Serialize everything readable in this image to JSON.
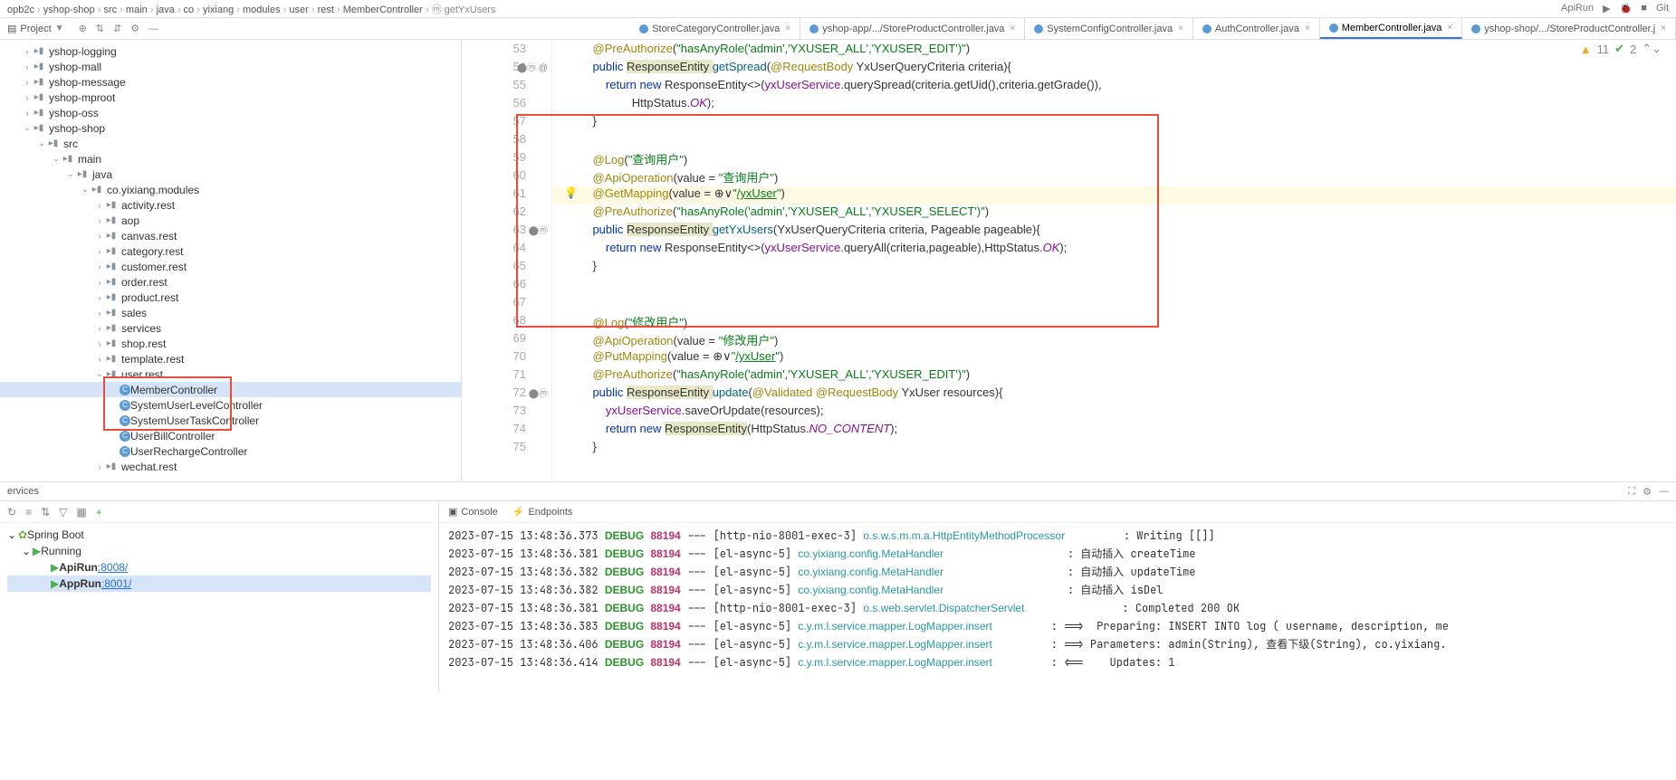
{
  "breadcrumbs": [
    "opb2c",
    "yshop-shop",
    "src",
    "main",
    "java",
    "co",
    "yixiang",
    "modules",
    "user",
    "rest",
    "MemberController"
  ],
  "topright_method": "getYxUsers",
  "topright_labels": [
    "ApiRun",
    "Git"
  ],
  "project_label": "Project",
  "file_tabs": [
    {
      "name": "StoreCategoryController.java",
      "active": false
    },
    {
      "name": "yshop-app/.../StoreProductController.java",
      "active": false
    },
    {
      "name": "SystemConfigController.java",
      "active": false
    },
    {
      "name": "AuthController.java",
      "active": false
    },
    {
      "name": "MemberController.java",
      "active": true
    },
    {
      "name": "yshop-shop/.../StoreProductController.j",
      "active": false
    }
  ],
  "lint_warn": "11",
  "lint_ok": "2",
  "tree": [
    {
      "ind": 1,
      "exp": "›",
      "icon": "folder",
      "label": "yshop-logging"
    },
    {
      "ind": 1,
      "exp": "›",
      "icon": "folder",
      "label": "yshop-mall"
    },
    {
      "ind": 1,
      "exp": "›",
      "icon": "folder",
      "label": "yshop-message"
    },
    {
      "ind": 1,
      "exp": "›",
      "icon": "folder",
      "label": "yshop-mproot"
    },
    {
      "ind": 1,
      "exp": "›",
      "icon": "folder",
      "label": "yshop-oss"
    },
    {
      "ind": 1,
      "exp": "⌄",
      "icon": "folder",
      "label": "yshop-shop"
    },
    {
      "ind": 2,
      "exp": "⌄",
      "icon": "folder",
      "label": "src"
    },
    {
      "ind": 3,
      "exp": "⌄",
      "icon": "folder",
      "label": "main"
    },
    {
      "ind": 4,
      "exp": "⌄",
      "icon": "folder",
      "label": "java"
    },
    {
      "ind": 5,
      "exp": "⌄",
      "icon": "folder",
      "label": "co.yixiang.modules"
    },
    {
      "ind": 6,
      "exp": "›",
      "icon": "folder",
      "label": "activity.rest"
    },
    {
      "ind": 6,
      "exp": "›",
      "icon": "folder",
      "label": "aop"
    },
    {
      "ind": 6,
      "exp": "›",
      "icon": "folder",
      "label": "canvas.rest"
    },
    {
      "ind": 6,
      "exp": "›",
      "icon": "folder",
      "label": "category.rest"
    },
    {
      "ind": 6,
      "exp": "›",
      "icon": "folder",
      "label": "customer.rest"
    },
    {
      "ind": 6,
      "exp": "›",
      "icon": "folder",
      "label": "order.rest"
    },
    {
      "ind": 6,
      "exp": "›",
      "icon": "folder",
      "label": "product.rest"
    },
    {
      "ind": 6,
      "exp": "›",
      "icon": "folder",
      "label": "sales"
    },
    {
      "ind": 6,
      "exp": "›",
      "icon": "folder",
      "label": "services"
    },
    {
      "ind": 6,
      "exp": "›",
      "icon": "folder",
      "label": "shop.rest"
    },
    {
      "ind": 6,
      "exp": "›",
      "icon": "folder",
      "label": "template.rest"
    },
    {
      "ind": 6,
      "exp": "⌄",
      "icon": "folder",
      "label": "user.rest"
    },
    {
      "ind": 7,
      "exp": "",
      "icon": "java",
      "label": "MemberController",
      "sel": true
    },
    {
      "ind": 7,
      "exp": "",
      "icon": "java",
      "label": "SystemUserLevelController"
    },
    {
      "ind": 7,
      "exp": "",
      "icon": "java",
      "label": "SystemUserTaskController"
    },
    {
      "ind": 7,
      "exp": "",
      "icon": "java",
      "label": "UserBillController"
    },
    {
      "ind": 7,
      "exp": "",
      "icon": "java",
      "label": "UserRechargeController"
    },
    {
      "ind": 6,
      "exp": "›",
      "icon": "folder",
      "label": "wechat.rest"
    }
  ],
  "line_start": 53,
  "line_count": 23,
  "caret_ln": 61,
  "gutter_markers": {
    "54": "⬤ⓜ @",
    "63": "⬤ⓜ",
    "72": "⬤ⓜ"
  },
  "code": {
    "53": [
      [
        "    ",
        ""
      ],
      [
        "@PreAuthorize",
        "anno"
      ],
      [
        "(",
        ""
      ],
      [
        "\"hasAnyRole('admin','YXUSER_ALL','YXUSER_EDIT')\"",
        "str"
      ],
      [
        ")",
        ""
      ]
    ],
    "54": [
      [
        "    ",
        ""
      ],
      [
        "public ",
        "kw"
      ],
      [
        "ResponseEntity ",
        "type-hl"
      ],
      [
        "getSpread",
        "meth"
      ],
      [
        "(",
        ""
      ],
      [
        "@RequestBody",
        "anno"
      ],
      [
        " YxUserQueryCriteria criteria){",
        ""
      ]
    ],
    "55": [
      [
        "        ",
        ""
      ],
      [
        "return ",
        "kw"
      ],
      [
        "new ",
        "kw"
      ],
      [
        "ResponseEntity<>(",
        ""
      ],
      [
        "yxUserService",
        "field"
      ],
      [
        ".querySpread(criteria.getUid(),criteria.getGrade()),",
        ""
      ]
    ],
    "56": [
      [
        "                HttpStatus.",
        ""
      ],
      [
        "OK",
        "const"
      ],
      [
        ");",
        ""
      ]
    ],
    "57": [
      [
        "    }",
        ""
      ]
    ],
    "58": [
      [
        "",
        ""
      ]
    ],
    "59": [
      [
        "    ",
        ""
      ],
      [
        "@Log",
        "anno"
      ],
      [
        "(",
        ""
      ],
      [
        "\"查询用户\"",
        "str"
      ],
      [
        ")",
        ""
      ]
    ],
    "60": [
      [
        "    ",
        ""
      ],
      [
        "@ApiOperation",
        "anno"
      ],
      [
        "(value = ",
        ""
      ],
      [
        "\"查询用户\"",
        "str"
      ],
      [
        ")",
        ""
      ]
    ],
    "61": [
      [
        "    ",
        ""
      ],
      [
        "@GetMapping",
        "anno"
      ],
      [
        "(value = ⊕∨",
        ""
      ],
      [
        "\"",
        "str"
      ],
      [
        "/yxUser",
        "url"
      ],
      [
        "\"",
        "str"
      ],
      [
        ")",
        ""
      ]
    ],
    "62": [
      [
        "    ",
        ""
      ],
      [
        "@PreAuthorize",
        "anno"
      ],
      [
        "(",
        ""
      ],
      [
        "\"hasAnyRole('admin','YXUSER_ALL','YXUSER_SELECT')\"",
        "str"
      ],
      [
        ")",
        ""
      ]
    ],
    "63": [
      [
        "    ",
        ""
      ],
      [
        "public ",
        "kw"
      ],
      [
        "ResponseEntity ",
        "type-hl"
      ],
      [
        "getYxUsers",
        "meth"
      ],
      [
        "(YxUserQueryCriteria criteria, Pageable pageable){",
        ""
      ]
    ],
    "64": [
      [
        "        ",
        ""
      ],
      [
        "return ",
        "kw"
      ],
      [
        "new ",
        "kw"
      ],
      [
        "ResponseEntity<>(",
        ""
      ],
      [
        "yxUserService",
        "field"
      ],
      [
        ".queryAll(criteria,pageable),HttpStatus.",
        ""
      ],
      [
        "OK",
        "const"
      ],
      [
        ");",
        ""
      ]
    ],
    "65": [
      [
        "    }",
        ""
      ]
    ],
    "66": [
      [
        "",
        ""
      ]
    ],
    "67": [
      [
        "",
        ""
      ]
    ],
    "68": [
      [
        "    ",
        ""
      ],
      [
        "@Log",
        "anno"
      ],
      [
        "(",
        ""
      ],
      [
        "\"修改用户\"",
        "str"
      ],
      [
        ")",
        ""
      ]
    ],
    "69": [
      [
        "    ",
        ""
      ],
      [
        "@ApiOperation",
        "anno"
      ],
      [
        "(value = ",
        ""
      ],
      [
        "\"修改用户\"",
        "str"
      ],
      [
        ")",
        ""
      ]
    ],
    "70": [
      [
        "    ",
        ""
      ],
      [
        "@PutMapping",
        "anno"
      ],
      [
        "(value = ⊕∨",
        ""
      ],
      [
        "\"",
        "str"
      ],
      [
        "/yxUser",
        "url"
      ],
      [
        "\"",
        "str"
      ],
      [
        ")",
        ""
      ]
    ],
    "71": [
      [
        "    ",
        ""
      ],
      [
        "@PreAuthorize",
        "anno"
      ],
      [
        "(",
        ""
      ],
      [
        "\"hasAnyRole('admin','YXUSER_ALL','YXUSER_EDIT')\"",
        "str"
      ],
      [
        ")",
        ""
      ]
    ],
    "72": [
      [
        "    ",
        ""
      ],
      [
        "public ",
        "kw"
      ],
      [
        "ResponseEntity ",
        "type-hl"
      ],
      [
        "update",
        "meth"
      ],
      [
        "(",
        ""
      ],
      [
        "@Validated ",
        "anno"
      ],
      [
        "@RequestBody",
        "anno"
      ],
      [
        " YxUser resources){",
        ""
      ]
    ],
    "73": [
      [
        "        ",
        ""
      ],
      [
        "yxUserService",
        "field"
      ],
      [
        ".saveOrUpdate(resources);",
        ""
      ]
    ],
    "74": [
      [
        "        ",
        ""
      ],
      [
        "return ",
        "kw"
      ],
      [
        "new ",
        "kw"
      ],
      [
        "ResponseEntity",
        "type-hl"
      ],
      [
        "(HttpStatus.",
        ""
      ],
      [
        "NO_CONTENT",
        "const"
      ],
      [
        ");",
        ""
      ]
    ],
    "75": [
      [
        "    }",
        ""
      ]
    ]
  },
  "services_label": "ervices",
  "springboot_label": "Spring Boot",
  "running_label": "Running",
  "runs": [
    {
      "name": "ApiRun",
      "port": ":8008/"
    },
    {
      "name": "AppRun",
      "port": ":8001/",
      "sel": true
    }
  ],
  "console_tab": "Console",
  "endpoints_tab": "Endpoints",
  "logs": [
    {
      "ts": "2023-07-15 13:48:36.373",
      "lvl": "DEBUG",
      "pid": "88194",
      "thr": "[http-nio-8001-exec-3]",
      "cls": "o.s.w.s.m.m.a.HttpEntityMethodProcessor",
      "msg": ": Writing [[]]"
    },
    {
      "ts": "2023-07-15 13:48:36.381",
      "lvl": "DEBUG",
      "pid": "88194",
      "thr": "[el-async-5]",
      "cls": "co.yixiang.config.MetaHandler",
      "msg": ": 自动插入 createTime"
    },
    {
      "ts": "2023-07-15 13:48:36.382",
      "lvl": "DEBUG",
      "pid": "88194",
      "thr": "[el-async-5]",
      "cls": "co.yixiang.config.MetaHandler",
      "msg": ": 自动插入 updateTime"
    },
    {
      "ts": "2023-07-15 13:48:36.382",
      "lvl": "DEBUG",
      "pid": "88194",
      "thr": "[el-async-5]",
      "cls": "co.yixiang.config.MetaHandler",
      "msg": ": 自动插入 isDel"
    },
    {
      "ts": "2023-07-15 13:48:36.381",
      "lvl": "DEBUG",
      "pid": "88194",
      "thr": "[http-nio-8001-exec-3]",
      "cls": "o.s.web.servlet.DispatcherServlet",
      "msg": ": Completed 200 OK"
    },
    {
      "ts": "2023-07-15 13:48:36.383",
      "lvl": "DEBUG",
      "pid": "88194",
      "thr": "[el-async-5]",
      "cls": "c.y.m.l.service.mapper.LogMapper.insert",
      "msg": ": ==>  Preparing: INSERT INTO log ( username, description, me"
    },
    {
      "ts": "2023-07-15 13:48:36.406",
      "lvl": "DEBUG",
      "pid": "88194",
      "thr": "[el-async-5]",
      "cls": "c.y.m.l.service.mapper.LogMapper.insert",
      "msg": ": ==> Parameters: admin(String), 查看下级(String), co.yixiang."
    },
    {
      "ts": "2023-07-15 13:48:36.414",
      "lvl": "DEBUG",
      "pid": "88194",
      "thr": "[el-async-5]",
      "cls": "c.y.m.l.service.mapper.LogMapper.insert",
      "msg": ": <==    Updates: 1"
    }
  ]
}
